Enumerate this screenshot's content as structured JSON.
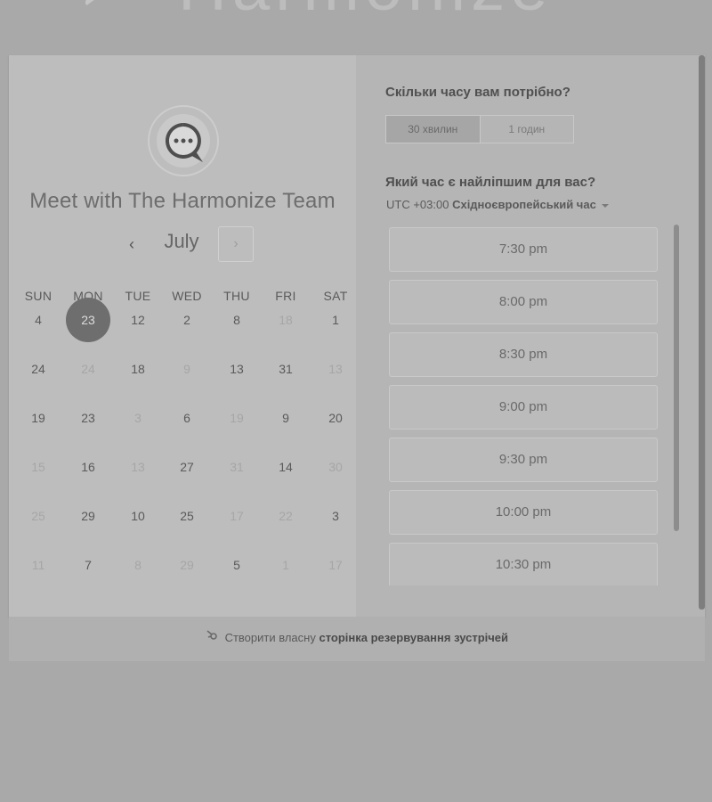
{
  "brand": {
    "logo_text": "Harmonize"
  },
  "host": {
    "title": "Meet with The Harmonize Team",
    "avatar_glyph": "chat-bubble-icon"
  },
  "calendar": {
    "month": "July",
    "prev_label": "‹",
    "next_label": "›",
    "weekdays": [
      "SUN",
      "MON",
      "TUE",
      "WED",
      "THU",
      "FRI",
      "SAT"
    ],
    "rows": [
      [
        {
          "d": "4",
          "dim": false
        },
        {
          "d": "23",
          "dim": false,
          "selected": true
        },
        {
          "d": "12",
          "dim": false
        },
        {
          "d": "2",
          "dim": false
        },
        {
          "d": "8",
          "dim": false
        },
        {
          "d": "18",
          "dim": true
        },
        {
          "d": "1",
          "dim": false
        }
      ],
      [
        {
          "d": "24",
          "dim": false
        },
        {
          "d": "24",
          "dim": true
        },
        {
          "d": "18",
          "dim": false
        },
        {
          "d": "9",
          "dim": true
        },
        {
          "d": "13",
          "dim": false
        },
        {
          "d": "31",
          "dim": false
        },
        {
          "d": "13",
          "dim": true
        }
      ],
      [
        {
          "d": "19",
          "dim": false
        },
        {
          "d": "23",
          "dim": false
        },
        {
          "d": "3",
          "dim": true
        },
        {
          "d": "6",
          "dim": false
        },
        {
          "d": "19",
          "dim": true
        },
        {
          "d": "9",
          "dim": false
        },
        {
          "d": "20",
          "dim": false
        }
      ],
      [
        {
          "d": "15",
          "dim": true
        },
        {
          "d": "16",
          "dim": false
        },
        {
          "d": "13",
          "dim": true
        },
        {
          "d": "27",
          "dim": false
        },
        {
          "d": "31",
          "dim": true
        },
        {
          "d": "14",
          "dim": false
        },
        {
          "d": "30",
          "dim": true
        }
      ],
      [
        {
          "d": "25",
          "dim": true
        },
        {
          "d": "29",
          "dim": false
        },
        {
          "d": "10",
          "dim": false
        },
        {
          "d": "25",
          "dim": false
        },
        {
          "d": "17",
          "dim": true
        },
        {
          "d": "22",
          "dim": true
        },
        {
          "d": "3",
          "dim": false
        }
      ],
      [
        {
          "d": "11",
          "dim": true
        },
        {
          "d": "7",
          "dim": false
        },
        {
          "d": "8",
          "dim": true
        },
        {
          "d": "29",
          "dim": true
        },
        {
          "d": "5",
          "dim": false
        },
        {
          "d": "1",
          "dim": true
        },
        {
          "d": "17",
          "dim": true
        }
      ]
    ]
  },
  "duration": {
    "question": "Скільки часу вам потрібно?",
    "options": [
      {
        "label": "30 хвилин",
        "active": true
      },
      {
        "label": "1 годин",
        "active": false
      }
    ]
  },
  "time": {
    "question": "Який час є найліпшим для вас?",
    "tz_offset": "UTC +03:00",
    "tz_name": "Східноєвропейський час",
    "slots": [
      "7:30 pm",
      "8:00 pm",
      "8:30 pm",
      "9:00 pm",
      "9:30 pm",
      "10:00 pm",
      "10:30 pm"
    ]
  },
  "footer": {
    "prefix": "Створити власну",
    "link": "сторінка резервування зустрічей"
  },
  "colors": {
    "background": "#a9a9a9",
    "panel_left": "#bdbdbd",
    "selected_day": "#6e6e6e"
  }
}
